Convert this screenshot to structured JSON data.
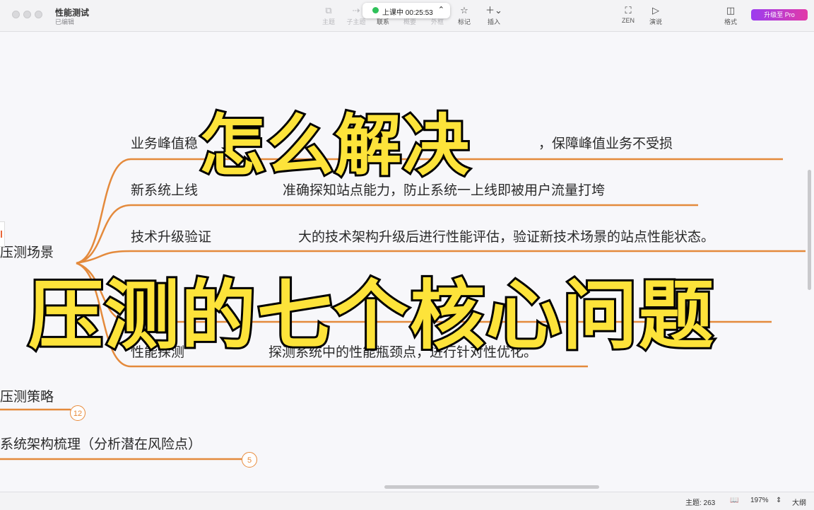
{
  "window": {
    "title": "性能测试",
    "subtitle": "已编辑"
  },
  "toolbar": {
    "topic": "主题",
    "subtopic": "子主题",
    "relation": "联系",
    "summary": "概要",
    "boundary": "外框",
    "marker": "标记",
    "insert": "插入",
    "zen": "ZEN",
    "present": "演说",
    "format": "格式",
    "upgrade": "升级至 Pro"
  },
  "timer": {
    "label": "上课中 00:25:53"
  },
  "mindmap": {
    "branch1": "压测场景",
    "children": [
      {
        "topic": "业务峰值稳",
        "desc": "，保障峰值业务不受损"
      },
      {
        "topic": "新系统上线",
        "desc": "准确探知站点能力，防止系统一上线即被用户流量打垮"
      },
      {
        "topic": "技术升级验证",
        "desc": "大的技术架构升级后进行性能评估，验证新技术场景的站点性能状态。"
      },
      {
        "topic": "",
        "desc": ""
      },
      {
        "topic": "性能探测",
        "desc": "探测系统中的性能瓶颈点，进行针对性优化。"
      }
    ],
    "branch2": "压测策略",
    "branch2_count": "12",
    "branch3": "系统架构梳理（分析潜在风险点）",
    "branch3_count": "5"
  },
  "overlay": {
    "headline": "怎么解决",
    "subline": "压测的七个核心问题"
  },
  "statusbar": {
    "topics": "主题: 263",
    "zoom": "197%",
    "outline": "大纲"
  }
}
